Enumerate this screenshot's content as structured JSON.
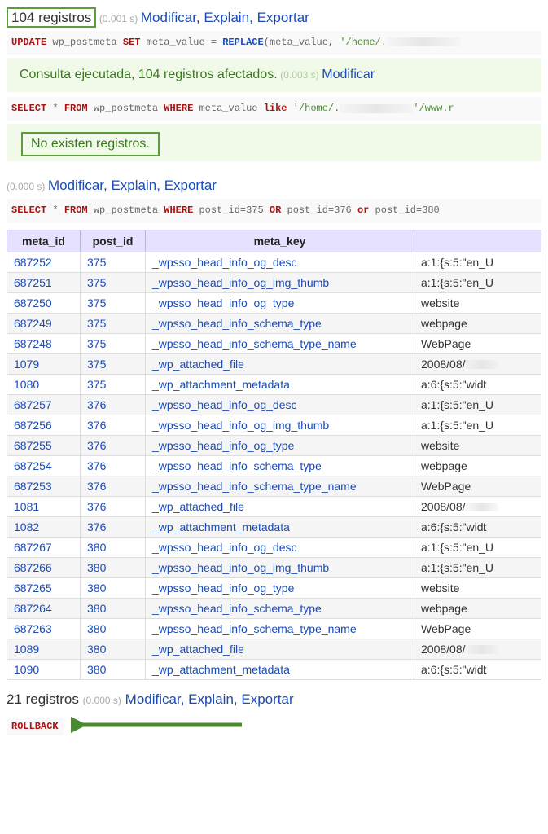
{
  "top": {
    "count_text": "104 registros",
    "timing": "(0.001 s)",
    "modificar": "Modificar",
    "explain": "Explain",
    "exportar": "Exportar"
  },
  "sql1": {
    "prefix_kw1": "UPDATE",
    "table": " wp_postmeta ",
    "set": "SET",
    "col": " meta_value = ",
    "fn": "REPLACE",
    "args_open": "(meta_value, ",
    "str1": "'/home/.",
    "tail": ""
  },
  "success": {
    "text": "Consulta ejecutada, 104 registros afectados.",
    "timing": "(0.003 s)",
    "modificar": "Modificar"
  },
  "sql2": {
    "kw1": "SELECT",
    "star": " * ",
    "kw2": "FROM",
    "tbl": " wp_postmeta ",
    "kw3": "WHERE",
    "col": " meta_value ",
    "kw4": "like",
    "str": " '/home/.",
    "tail": "'/www.r"
  },
  "no_records": "No existen registros.",
  "mid": {
    "timing": "(0.000 s)",
    "modificar": "Modificar",
    "explain": "Explain",
    "exportar": "Exportar"
  },
  "sql3": {
    "kw1": "SELECT",
    "star": " * ",
    "kw2": "FROM",
    "tbl": " wp_postmeta ",
    "kw3": "WHERE",
    "p1": " post_id=375 ",
    "or1": "OR",
    "p2": " post_id=376 ",
    "or2": "or",
    "p3": " post_id=380"
  },
  "columns": [
    "meta_id",
    "post_id",
    "meta_key",
    ""
  ],
  "rows": [
    {
      "meta_id": "687252",
      "post_id": "375",
      "meta_key": "_wpsso_head_info_og_desc",
      "val": "a:1:{s:5:\"en_U"
    },
    {
      "meta_id": "687251",
      "post_id": "375",
      "meta_key": "_wpsso_head_info_og_img_thumb",
      "val": "a:1:{s:5:\"en_U"
    },
    {
      "meta_id": "687250",
      "post_id": "375",
      "meta_key": "_wpsso_head_info_og_type",
      "val": "website"
    },
    {
      "meta_id": "687249",
      "post_id": "375",
      "meta_key": "_wpsso_head_info_schema_type",
      "val": "webpage"
    },
    {
      "meta_id": "687248",
      "post_id": "375",
      "meta_key": "_wpsso_head_info_schema_type_name",
      "val": "WebPage"
    },
    {
      "meta_id": "1079",
      "post_id": "375",
      "meta_key": "_wp_attached_file",
      "val": "2008/08/"
    },
    {
      "meta_id": "1080",
      "post_id": "375",
      "meta_key": "_wp_attachment_metadata",
      "val": "a:6:{s:5:\"widt"
    },
    {
      "meta_id": "687257",
      "post_id": "376",
      "meta_key": "_wpsso_head_info_og_desc",
      "val": "a:1:{s:5:\"en_U"
    },
    {
      "meta_id": "687256",
      "post_id": "376",
      "meta_key": "_wpsso_head_info_og_img_thumb",
      "val": "a:1:{s:5:\"en_U"
    },
    {
      "meta_id": "687255",
      "post_id": "376",
      "meta_key": "_wpsso_head_info_og_type",
      "val": "website"
    },
    {
      "meta_id": "687254",
      "post_id": "376",
      "meta_key": "_wpsso_head_info_schema_type",
      "val": "webpage"
    },
    {
      "meta_id": "687253",
      "post_id": "376",
      "meta_key": "_wpsso_head_info_schema_type_name",
      "val": "WebPage"
    },
    {
      "meta_id": "1081",
      "post_id": "376",
      "meta_key": "_wp_attached_file",
      "val": "2008/08/"
    },
    {
      "meta_id": "1082",
      "post_id": "376",
      "meta_key": "_wp_attachment_metadata",
      "val": "a:6:{s:5:\"widt"
    },
    {
      "meta_id": "687267",
      "post_id": "380",
      "meta_key": "_wpsso_head_info_og_desc",
      "val": "a:1:{s:5:\"en_U"
    },
    {
      "meta_id": "687266",
      "post_id": "380",
      "meta_key": "_wpsso_head_info_og_img_thumb",
      "val": "a:1:{s:5:\"en_U"
    },
    {
      "meta_id": "687265",
      "post_id": "380",
      "meta_key": "_wpsso_head_info_og_type",
      "val": "website"
    },
    {
      "meta_id": "687264",
      "post_id": "380",
      "meta_key": "_wpsso_head_info_schema_type",
      "val": "webpage"
    },
    {
      "meta_id": "687263",
      "post_id": "380",
      "meta_key": "_wpsso_head_info_schema_type_name",
      "val": "WebPage"
    },
    {
      "meta_id": "1089",
      "post_id": "380",
      "meta_key": "_wp_attached_file",
      "val": "2008/08/"
    },
    {
      "meta_id": "1090",
      "post_id": "380",
      "meta_key": "_wp_attachment_metadata",
      "val": "a:6:{s:5:\"widt"
    }
  ],
  "bottom": {
    "count_text": "21 registros",
    "timing": "(0.000 s)",
    "modificar": "Modificar",
    "explain": "Explain",
    "exportar": "Exportar"
  },
  "rollback": "ROLLBACK"
}
